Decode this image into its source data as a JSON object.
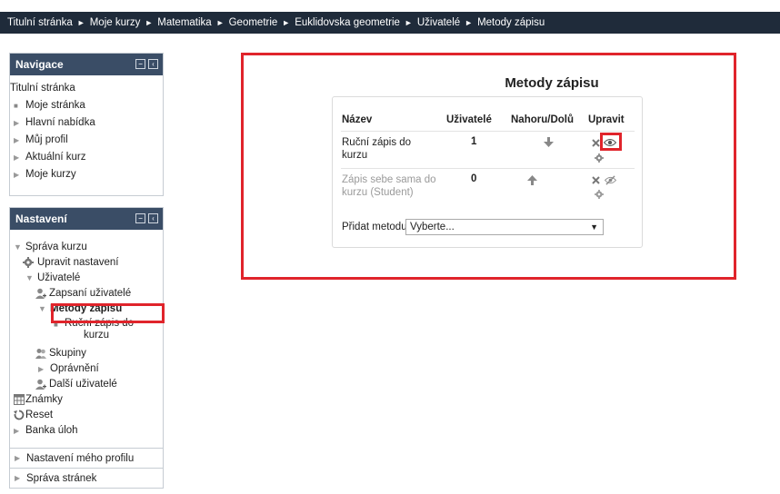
{
  "breadcrumb": {
    "items": [
      "Titulní stránka",
      "Moje kurzy",
      "Matematika",
      "Geometrie",
      "Euklidovska geometrie",
      "Uživatelé",
      "Metody zápisu"
    ],
    "separator": "►"
  },
  "navigation": {
    "title": "Navigace",
    "home": "Titulní stránka",
    "items": [
      "Moje stránka",
      "Hlavní nabídka",
      "Můj profil",
      "Aktuální kurz",
      "Moje kurzy"
    ]
  },
  "settings": {
    "title": "Nastavení",
    "course_admin": "Správa kurzu",
    "edit_settings": "Upravit nastavení",
    "users": "Uživatelé",
    "enrolled_users": "Zapsaní uživatelé",
    "enrolment_methods": "Metody zápisu",
    "manual_line1": "Ruční zápis do",
    "manual_line2": "kurzu",
    "groups": "Skupiny",
    "permissions": "Oprávnění",
    "other_users": "Další uživatelé",
    "grades": "Známky",
    "reset": "Reset",
    "question_bank": "Banka úloh",
    "my_profile_settings": "Nastavení mého profilu",
    "site_admin": "Správa stránek"
  },
  "main": {
    "title": "Metody zápisu",
    "columns": {
      "name": "Název",
      "users": "Uživatelé",
      "updown": "Nahoru/Dolů",
      "edit": "Upravit"
    },
    "rows": [
      {
        "name_line1": "Ruční zápis do",
        "name_line2": "kurzu",
        "users": "1",
        "enabled": true
      },
      {
        "name_line1": "Zápis sebe sama do",
        "name_line2": "kurzu (Student)",
        "users": "0",
        "enabled": false
      }
    ],
    "add_method_label": "Přidat metodu",
    "add_method_value": "Vyberte..."
  },
  "colors": {
    "header_bar": "#1f2b3a",
    "block_header": "#3a4d66",
    "highlight_red": "#e0242b"
  }
}
